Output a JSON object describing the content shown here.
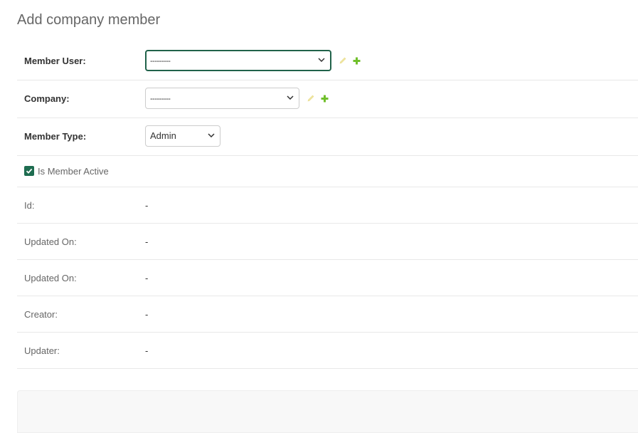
{
  "page": {
    "title": "Add company member"
  },
  "form": {
    "member_user": {
      "label": "Member User:",
      "value": "---------"
    },
    "company": {
      "label": "Company:",
      "value": "---------"
    },
    "member_type": {
      "label": "Member Type:",
      "value": "Admin"
    },
    "is_member_active": {
      "label": "Is Member Active",
      "checked": true
    },
    "readonly": [
      {
        "label": "Id:",
        "value": "-"
      },
      {
        "label": "Updated On:",
        "value": "-"
      },
      {
        "label": "Updated On:",
        "value": "-"
      },
      {
        "label": "Creator:",
        "value": "-"
      },
      {
        "label": "Updater:",
        "value": "-"
      }
    ]
  },
  "icons": {
    "edit": "pencil-icon",
    "add": "plus-icon",
    "dropdown": "chevron-down-icon",
    "check": "checkmark-icon"
  },
  "colors": {
    "accent": "#20624a",
    "checkbox": "#1e6c50",
    "add_icon": "#70bf2b",
    "edit_icon_disabled": "#f0e6a0",
    "title": "#666666"
  }
}
